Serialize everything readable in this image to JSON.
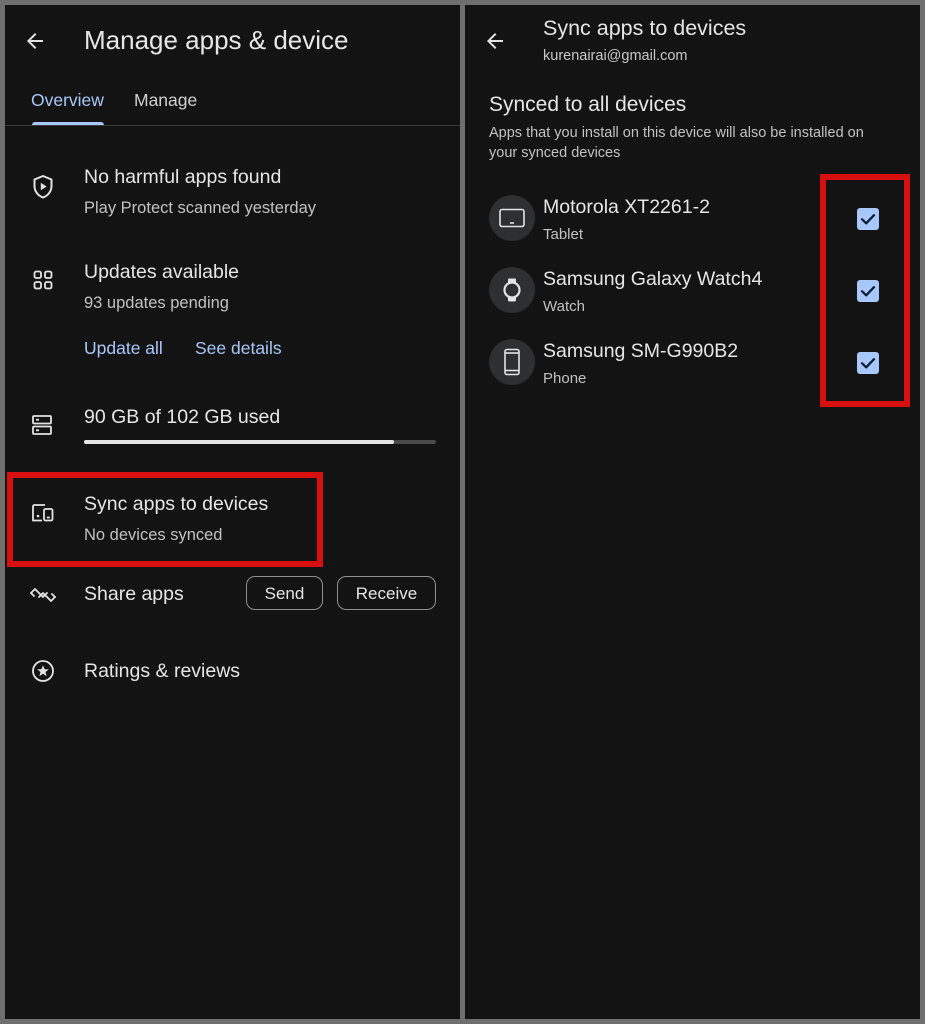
{
  "left": {
    "title": "Manage apps & device",
    "tabs": [
      {
        "label": "Overview",
        "active": true
      },
      {
        "label": "Manage",
        "active": false
      }
    ],
    "protect": {
      "icon": "shield-play-icon",
      "title": "No harmful apps found",
      "subtitle": "Play Protect scanned yesterday"
    },
    "updates": {
      "icon": "apps-grid-icon",
      "title": "Updates available",
      "subtitle": "93 updates pending",
      "update_all": "Update all",
      "see_details": "See details"
    },
    "storage": {
      "icon": "storage-icon",
      "title": "90 GB of 102 GB used",
      "used_fraction": 0.882
    },
    "sync": {
      "icon": "devices-icon",
      "title": "Sync apps to devices",
      "subtitle": "No devices synced"
    },
    "share": {
      "icon": "share-apps-icon",
      "title": "Share apps",
      "send": "Send",
      "receive": "Receive"
    },
    "ratings": {
      "icon": "star-circle-icon",
      "title": "Ratings & reviews"
    }
  },
  "right": {
    "title": "Sync apps to devices",
    "account": "kurenairai@gmail.com",
    "section_title": "Synced to all devices",
    "section_desc_line1": "Apps that you install on this device will also be installed on",
    "section_desc_line2": "your synced devices",
    "devices": [
      {
        "name": "Motorola XT2261-2",
        "type": "Tablet",
        "icon": "tablet-icon",
        "checked": true
      },
      {
        "name": "Samsung Galaxy Watch4",
        "type": "Watch",
        "icon": "watch-icon",
        "checked": true
      },
      {
        "name": "Samsung SM-G990B2",
        "type": "Phone",
        "icon": "phone-icon",
        "checked": true
      }
    ]
  },
  "colors": {
    "accent": "#a8c7fa",
    "background": "#131313",
    "highlight": "#d70f0f"
  }
}
